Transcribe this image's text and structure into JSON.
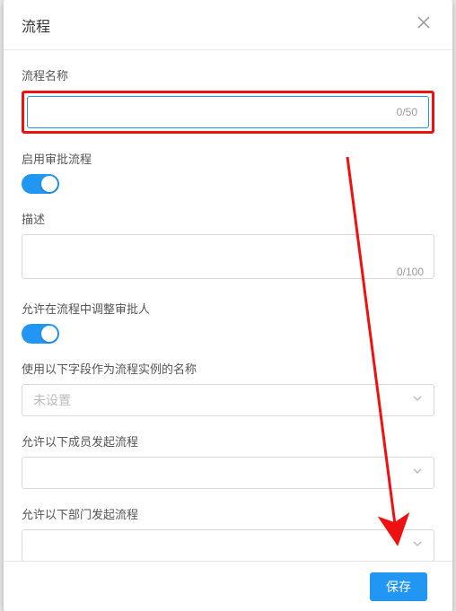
{
  "modal": {
    "title": "流程",
    "fields": {
      "name": {
        "label": "流程名称",
        "value": "",
        "counter": "0/50"
      },
      "enable_approval": {
        "label": "启用审批流程",
        "on": true
      },
      "description": {
        "label": "描述",
        "value": "",
        "counter": "0/100"
      },
      "allow_adjust": {
        "label": "允许在流程中调整审批人",
        "on": true
      },
      "instance_name_field": {
        "label": "使用以下字段作为流程实例的名称",
        "placeholder": "未设置"
      },
      "allow_members": {
        "label": "允许以下成员发起流程",
        "placeholder": ""
      },
      "allow_depts": {
        "label": "允许以下部门发起流程",
        "placeholder": ""
      }
    },
    "footer": {
      "save": "保存"
    }
  },
  "annotations": {
    "highlight_color": "#e11",
    "arrow_color": "#e11"
  }
}
